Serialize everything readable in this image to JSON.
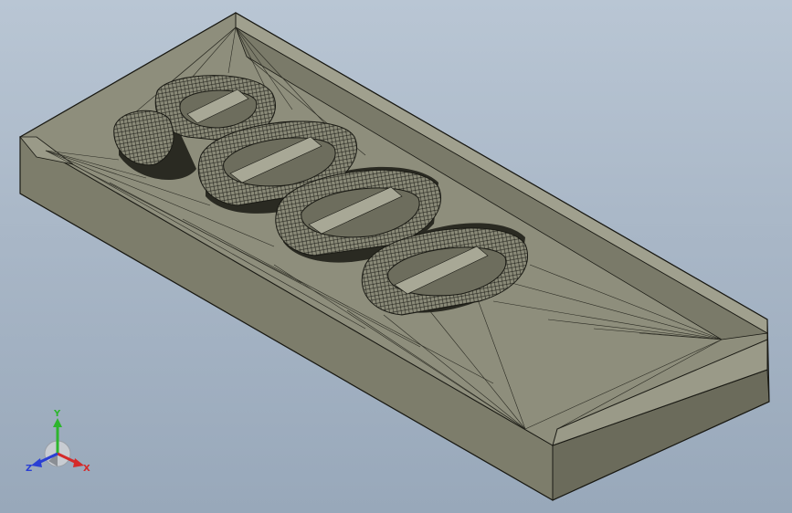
{
  "triad": {
    "x_label": "X",
    "y_label": "Y",
    "z_label": "Z",
    "x_color": "#d42a2a",
    "y_color": "#2db52d",
    "z_color": "#2a3fd4"
  },
  "model": {
    "face_top_color": "#8e8e7c",
    "face_side_color": "#6f6f5f",
    "face_dark_color": "#5a5a4c",
    "edge_color": "#1a1a14"
  }
}
